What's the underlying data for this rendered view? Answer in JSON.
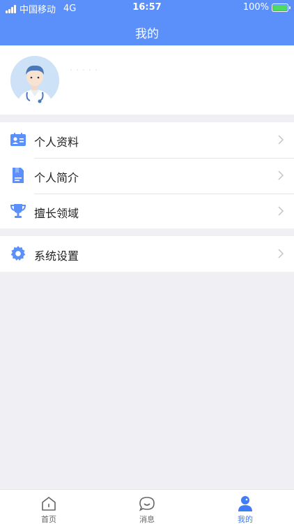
{
  "status_bar": {
    "carrier": "中国移动",
    "network": "4G",
    "time": "16:57",
    "battery": "100%"
  },
  "header": {
    "title": "我的"
  },
  "profile": {
    "name": "· · · · ·"
  },
  "menu": {
    "group1": [
      {
        "label": "个人资料",
        "icon": "profile-card-icon"
      },
      {
        "label": "个人简介",
        "icon": "document-icon"
      },
      {
        "label": "擅长领域",
        "icon": "trophy-icon"
      }
    ],
    "group2": [
      {
        "label": "系统设置",
        "icon": "gear-icon"
      }
    ]
  },
  "tabbar": {
    "tabs": [
      {
        "label": "首页",
        "icon": "home-icon"
      },
      {
        "label": "消息",
        "icon": "message-icon"
      },
      {
        "label": "我的",
        "icon": "user-icon",
        "active": true
      }
    ]
  },
  "colors": {
    "primary": "#5b8ff9",
    "active_tab": "#3f7cf6",
    "background": "#efeff4"
  }
}
